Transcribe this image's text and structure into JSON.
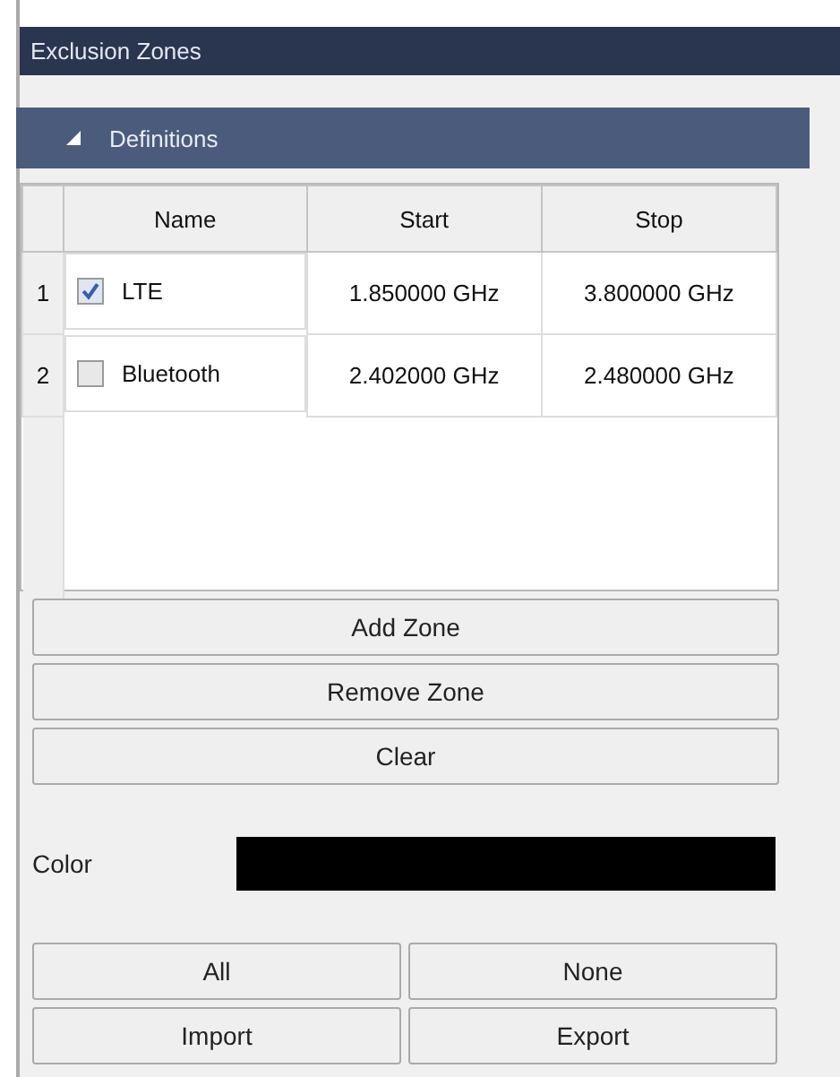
{
  "window": {
    "title": "Exclusion Zones"
  },
  "section": {
    "title": "Definitions",
    "expanded": true
  },
  "table": {
    "columns": [
      "Name",
      "Start",
      "Stop"
    ],
    "rows": [
      {
        "number": "1",
        "checked": true,
        "name": "LTE",
        "start": "1.850000 GHz",
        "stop": "3.800000 GHz"
      },
      {
        "number": "2",
        "checked": false,
        "name": "Bluetooth",
        "start": "2.402000 GHz",
        "stop": "2.480000 GHz"
      }
    ]
  },
  "zone_buttons": [
    "Add Zone",
    "Remove Zone",
    "Clear"
  ],
  "color_field": {
    "label": "Color",
    "color": "#000000"
  },
  "bottom_buttons": [
    "All",
    "None",
    "Import",
    "Export"
  ]
}
